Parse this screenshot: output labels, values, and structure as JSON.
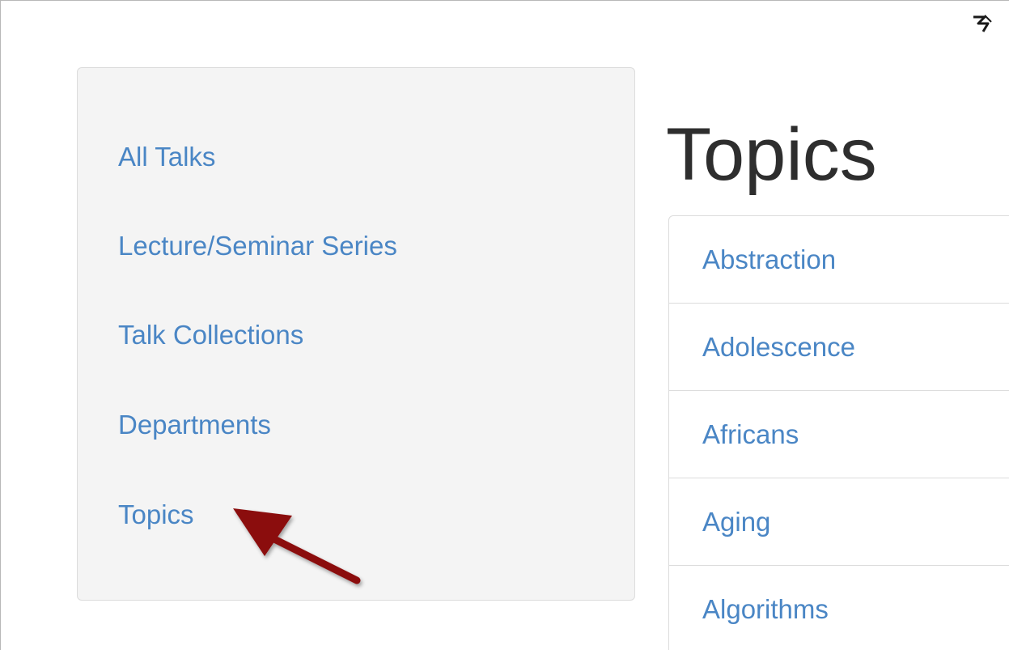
{
  "sidebar": {
    "items": [
      {
        "label": "All Talks"
      },
      {
        "label": "Lecture/Seminar Series"
      },
      {
        "label": "Talk Collections"
      },
      {
        "label": "Departments"
      },
      {
        "label": "Topics"
      }
    ]
  },
  "main": {
    "title": "Topics",
    "topics": [
      {
        "label": "Abstraction"
      },
      {
        "label": "Adolescence"
      },
      {
        "label": "Africans"
      },
      {
        "label": "Aging"
      },
      {
        "label": "Algorithms"
      }
    ]
  },
  "icons": {
    "corner": "pen-cursor-icon",
    "annotation": "annotation-arrow"
  },
  "colors": {
    "link": "#4a86c5",
    "title": "#2e2e2e",
    "panel_bg": "#f4f4f4",
    "arrow": "#8b0f10"
  }
}
